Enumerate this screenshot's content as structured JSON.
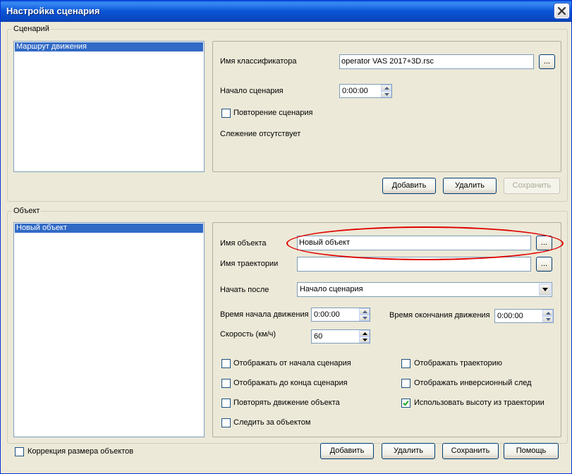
{
  "window": {
    "title": "Настройка сценария"
  },
  "scenario_group": {
    "legend": "Сценарий",
    "list_items": [
      "Маршрут движения"
    ],
    "classifier_label": "Имя классификатора",
    "classifier_value": "operator VAS 2017+3D.rsc",
    "ellipsis": "...",
    "start_label": "Начало сценария",
    "start_value": "0:00:00",
    "repeat_label": "Повторение сценария",
    "repeat_checked": false,
    "tracking_text": "Слежение отсутствует",
    "add_label": "Добавить",
    "delete_label": "Удалить",
    "save_label": "Сохранить"
  },
  "object_group": {
    "legend": "Объект",
    "list_items": [
      "Новый объект"
    ],
    "object_name_label": "Имя объекта",
    "object_name_value": "Новый объект",
    "trajectory_label": "Имя траектории",
    "trajectory_value": "",
    "ellipsis": "...",
    "start_after_label": "Начать после",
    "start_after_value": "Начало сценария",
    "move_start_label": "Время начала движения",
    "move_start_value": "0:00:00",
    "move_end_label": "Время окончания движения",
    "move_end_value": "0:00:00",
    "speed_label": "Скорость (км/ч)",
    "speed_value": "60",
    "checkboxes": [
      {
        "label": "Отображать от начала сценария",
        "checked": false
      },
      {
        "label": "Отображать до конца сценария",
        "checked": false
      },
      {
        "label": "Повторять движение объекта",
        "checked": false
      },
      {
        "label": "Следить за объектом",
        "checked": false
      },
      {
        "label": "Отображать траекторию",
        "checked": false
      },
      {
        "label": "Отображать инверсионный след",
        "checked": false
      },
      {
        "label": "Использовать высоту из траектории",
        "checked": true
      }
    ]
  },
  "footer": {
    "resize_label": "Коррекция размера объектов",
    "resize_checked": false,
    "add_label": "Добавить",
    "delete_label": "Удалить",
    "save_label": "Сохранить",
    "help_label": "Помощь"
  },
  "colors": {
    "title_bar": "#0a55d6",
    "selection": "#316ac5",
    "highlight_ellipse": "#e00000"
  }
}
